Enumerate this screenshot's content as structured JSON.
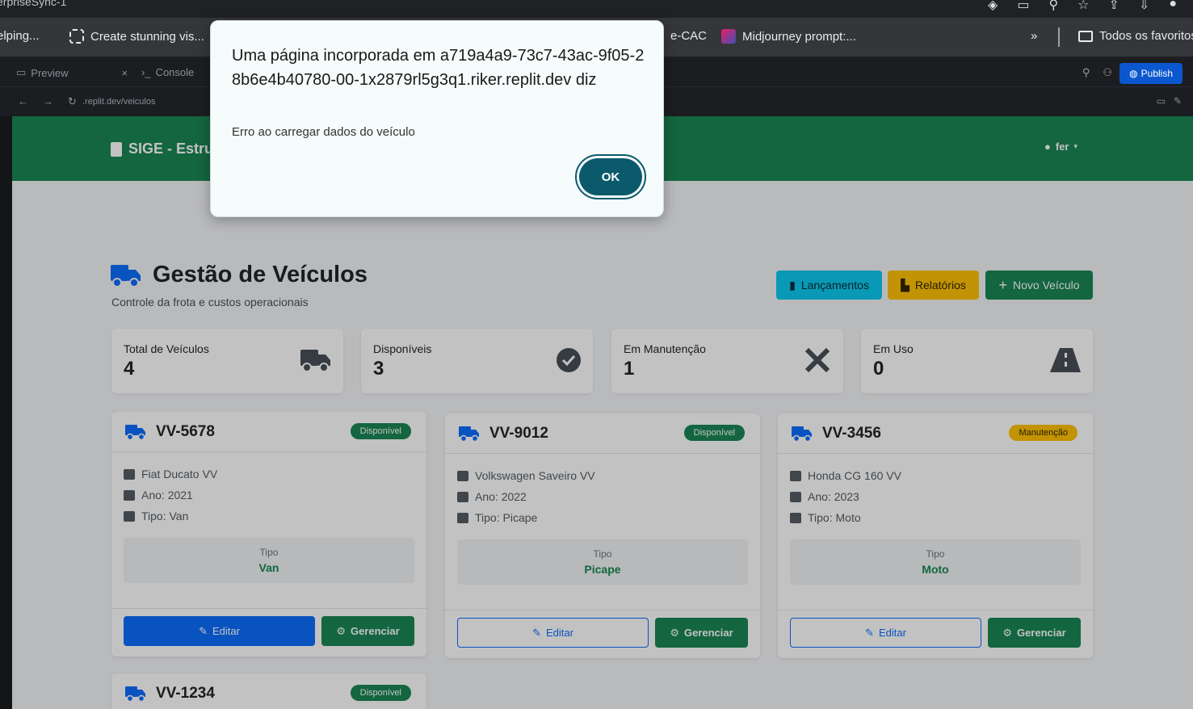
{
  "browser": {
    "tab_title": "erpriseSync-1",
    "bookmarks": [
      {
        "label": "elping..."
      },
      {
        "label": "Create stunning vis..."
      },
      {
        "label": "e-CAC"
      },
      {
        "label": "Midjourney prompt:..."
      },
      {
        "label": "Todos os favoritos"
      }
    ],
    "more": "»"
  },
  "devtools": {
    "tabs": [
      {
        "label": "Preview"
      },
      {
        "label": "Console"
      }
    ],
    "publish": "Publish",
    "url": ".replit.dev/veiculos"
  },
  "app": {
    "brand": "SIGE - Estru",
    "user": "fer",
    "page_title": "Gestão de Veículos",
    "page_subtitle": "Controle da frota e custos operacionais",
    "buttons": {
      "lancamentos": "Lançamentos",
      "relatorios": "Relatórios",
      "novo": "Novo Veículo"
    },
    "stats": [
      {
        "label": "Total de Veículos",
        "value": "4"
      },
      {
        "label": "Disponíveis",
        "value": "3"
      },
      {
        "label": "Em Manutenção",
        "value": "1"
      },
      {
        "label": "Em Uso",
        "value": "0"
      }
    ],
    "vehicles": [
      {
        "plate": "VV-5678",
        "status": "Disponível",
        "model": "Fiat Ducato VV",
        "year": "Ano: 2021",
        "type": "Tipo: Van",
        "tipo_label": "Tipo",
        "tipo_value": "Van"
      },
      {
        "plate": "VV-9012",
        "status": "Disponível",
        "model": "Volkswagen Saveiro VV",
        "year": "Ano: 2022",
        "type": "Tipo: Picape",
        "tipo_label": "Tipo",
        "tipo_value": "Picape"
      },
      {
        "plate": "VV-3456",
        "status": "Manutenção",
        "model": "Honda CG 160 VV",
        "year": "Ano: 2023",
        "type": "Tipo: Moto",
        "tipo_label": "Tipo",
        "tipo_value": "Moto"
      },
      {
        "plate": "VV-1234",
        "status": "Disponível"
      }
    ],
    "edit_label": "Editar",
    "manage_label": "Gerenciar"
  },
  "dialog": {
    "title": "Uma página incorporada em a719a4a9-73c7-43ac-9f05-28b6e4b40780-00-1x2879rl5g3q1.riker.replit.dev diz",
    "message": "Erro ao carregar dados do veículo",
    "ok": "OK"
  }
}
